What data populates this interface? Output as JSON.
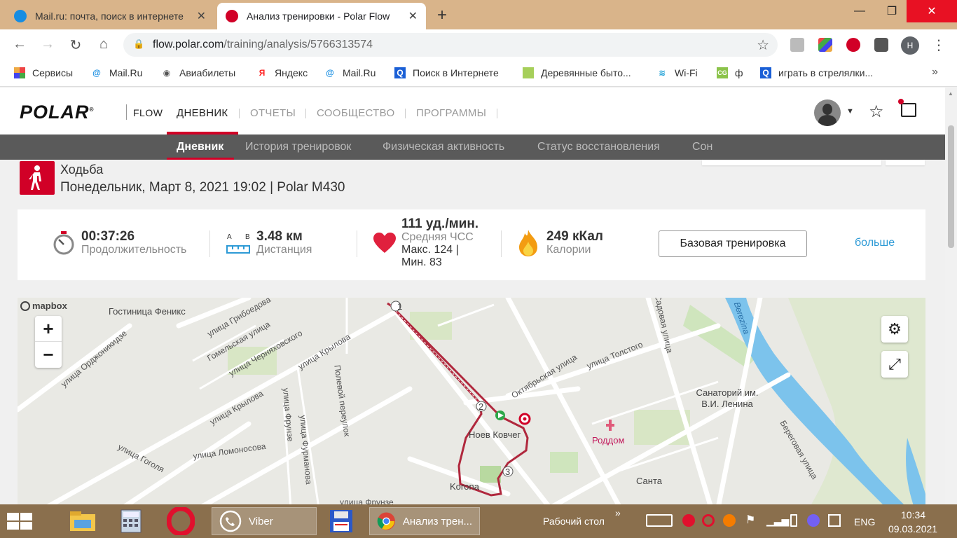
{
  "browser": {
    "tabs": [
      {
        "title": "Mail.ru: почта, поиск в интернете",
        "active": false
      },
      {
        "title": "Анализ тренировки - Polar Flow",
        "active": true
      }
    ],
    "url_host": "flow.polar.com",
    "url_path": "/training/analysis/5766313574",
    "profile_initial": "H",
    "bookmarks": [
      "Сервисы",
      "Mail.Ru",
      "Авиабилеты",
      "Яндекс",
      "Mail.Ru",
      "Поиск в Интернете",
      "Деревянные быто...",
      "Wi-Fi",
      "ф",
      "играть в стрелялки..."
    ],
    "bookmarks_more": "»"
  },
  "polar": {
    "logo": "POLAR",
    "logo_mark": "®",
    "flow": "FLOW",
    "nav": [
      "ДНЕВНИК",
      "ОТЧЕТЫ",
      "СООБЩЕСТВО",
      "ПРОГРАММЫ"
    ],
    "subnav": [
      "Дневник",
      "История тренировок",
      "Физическая активность",
      "Статус восстановления",
      "Сон"
    ]
  },
  "training": {
    "sport": "Ходьба",
    "date_device": "Понедельник, Март 8, 2021 19:02 | Polar M430",
    "duration_value": "00:37:26",
    "duration_label": "Продолжительность",
    "distance_value": "3.48 км",
    "distance_label": "Дистанция",
    "hr_value": "111 уд./мин.",
    "hr_label": "Средняя ЧСС",
    "hr_max": "Макс. 124  |",
    "hr_min": "Мин. 83",
    "calories_value": "249 кКал",
    "calories_label": "Калории",
    "benefit_button": "Базовая тренировка",
    "more_link": "больше"
  },
  "map": {
    "attribution": "mapbox",
    "zoom_in": "+",
    "zoom_out": "−",
    "labels": [
      "Гостиница Феникс",
      "улица Грибоедова",
      "Гомельская улица",
      "улица Черняховского",
      "улица Крылова",
      "улица Орджоникидзе",
      "улица Крылова",
      "Полевой переулок",
      "улица Фрунзе",
      "улица Фурманова",
      "улица Ломоносова",
      "улица Гоголя",
      "Октябрьская улица",
      "улица Толстого",
      "Садовая улица",
      "Санаторий им. В.И. Ленина",
      "Роддом",
      "Береговая улица",
      "Санта",
      "Korona",
      "улица Фрунзе",
      "Berezina",
      "Ноев Ковчег"
    ],
    "route_markers": [
      "1",
      "2",
      "3"
    ]
  },
  "taskbar": {
    "viber": "Viber",
    "chrome": "Анализ трен...",
    "desktop": "Рабочий стол",
    "chevron": "»",
    "lang": "ENG",
    "time": "10:34",
    "date": "09.03.2021"
  },
  "colors": {
    "polar_red": "#d10027",
    "route": "#b0283d",
    "link": "#2d9ad6"
  }
}
